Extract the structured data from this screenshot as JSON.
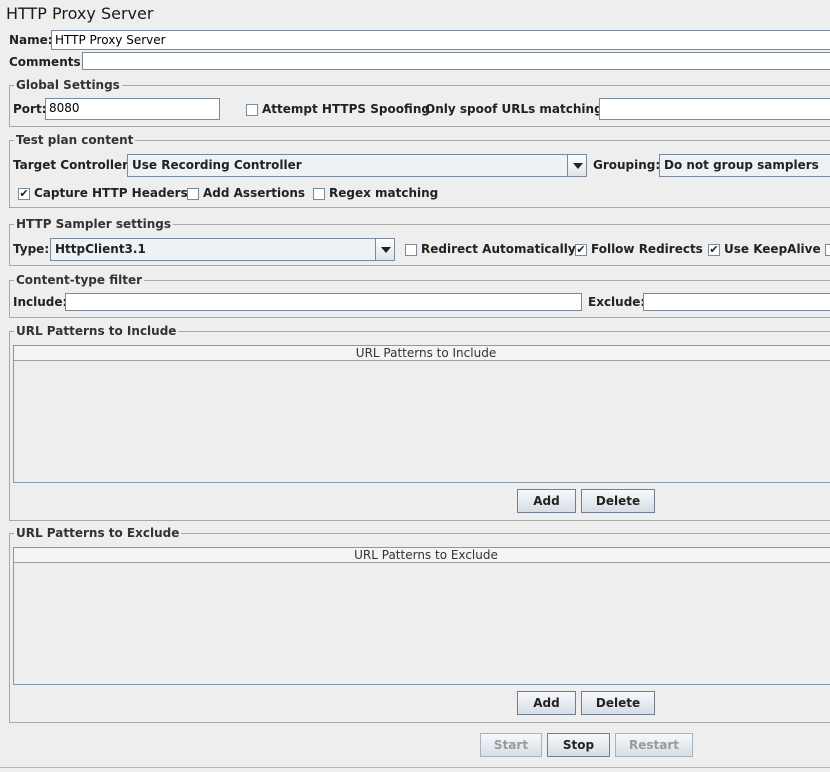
{
  "title": "HTTP Proxy Server",
  "name": {
    "label": "Name:",
    "value": "HTTP Proxy Server"
  },
  "comments": {
    "label": "Comments:",
    "value": ""
  },
  "global": {
    "legend": "Global Settings",
    "port_label": "Port:",
    "port_value": "8080",
    "https_spoof_label": "Attempt HTTPS Spoofing",
    "https_spoof_checked": false,
    "spoof_urls_label": "Only spoof URLs matching:",
    "spoof_urls_value": ""
  },
  "test_plan": {
    "legend": "Test plan content",
    "target_label": "Target Controller:",
    "target_value": "Use Recording Controller",
    "grouping_label": "Grouping:",
    "grouping_value": "Do not group samplers",
    "capture_headers_label": "Capture HTTP Headers",
    "capture_headers_checked": true,
    "add_assertions_label": "Add Assertions",
    "add_assertions_checked": false,
    "regex_label": "Regex matching",
    "regex_checked": false
  },
  "sampler": {
    "legend": "HTTP Sampler settings",
    "type_label": "Type:",
    "type_value": "HttpClient3.1",
    "redirect_auto_label": "Redirect Automatically",
    "redirect_auto_checked": false,
    "follow_redirects_label": "Follow Redirects",
    "follow_redirects_checked": true,
    "keepalive_label": "Use KeepAlive",
    "keepalive_checked": true
  },
  "content_filter": {
    "legend": "Content-type filter",
    "include_label": "Include:",
    "include_value": "",
    "exclude_label": "Exclude:",
    "exclude_value": ""
  },
  "include_patterns": {
    "legend": "URL Patterns to Include",
    "column": "URL Patterns to Include",
    "rows": [],
    "add_label": "Add",
    "delete_label": "Delete"
  },
  "exclude_patterns": {
    "legend": "URL Patterns to Exclude",
    "column": "URL Patterns to Exclude",
    "rows": [],
    "add_label": "Add",
    "delete_label": "Delete"
  },
  "controls": {
    "start_label": "Start",
    "start_enabled": false,
    "stop_label": "Stop",
    "stop_enabled": true,
    "restart_label": "Restart",
    "restart_enabled": false
  },
  "check_glyph": "✔"
}
